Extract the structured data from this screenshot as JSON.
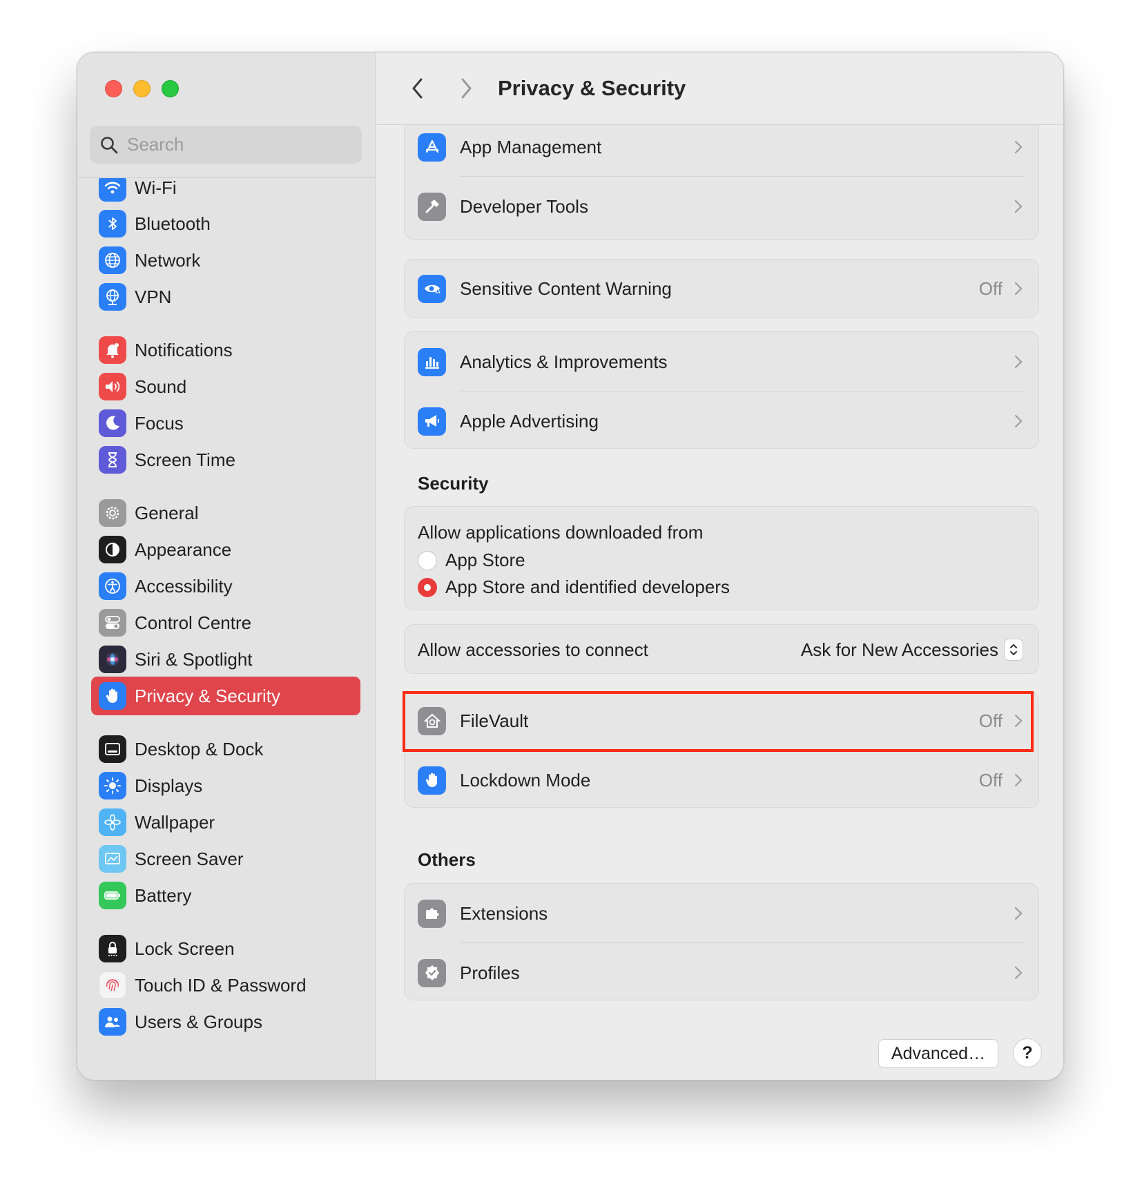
{
  "window": {
    "title": "Privacy & Security"
  },
  "search": {
    "placeholder": "Search"
  },
  "sidebar": {
    "items": [
      {
        "label": "Wi-Fi",
        "icon": "wifi-icon",
        "color": "#2b7ff6"
      },
      {
        "label": "Bluetooth",
        "icon": "bluetooth-icon",
        "color": "#2b7ff6"
      },
      {
        "label": "Network",
        "icon": "globe-icon",
        "color": "#2b7ff6"
      },
      {
        "label": "VPN",
        "icon": "vpn-globe-icon",
        "color": "#2b7ff6"
      },
      {
        "label": "Notifications",
        "icon": "bell-icon",
        "color": "#ef4a4a"
      },
      {
        "label": "Sound",
        "icon": "speaker-icon",
        "color": "#ef4a4a"
      },
      {
        "label": "Focus",
        "icon": "moon-icon",
        "color": "#5f5ad8"
      },
      {
        "label": "Screen Time",
        "icon": "hourglass-icon",
        "color": "#5f5ad8"
      },
      {
        "label": "General",
        "icon": "gear-icon",
        "color": "#9a9a9a"
      },
      {
        "label": "Appearance",
        "icon": "appearance-icon",
        "color": "#1e1e1e"
      },
      {
        "label": "Accessibility",
        "icon": "accessibility-icon",
        "color": "#2b7ff6"
      },
      {
        "label": "Control Centre",
        "icon": "toggles-icon",
        "color": "#9a9a9a"
      },
      {
        "label": "Siri & Spotlight",
        "icon": "siri-icon",
        "color": "#2a2a3a"
      },
      {
        "label": "Privacy & Security",
        "icon": "hand-icon",
        "color": "#2b7ff6",
        "active": true
      },
      {
        "label": "Desktop & Dock",
        "icon": "dock-icon",
        "color": "#1e1e1e"
      },
      {
        "label": "Displays",
        "icon": "sun-icon",
        "color": "#2b7ff6"
      },
      {
        "label": "Wallpaper",
        "icon": "flower-icon",
        "color": "#4fb3f6"
      },
      {
        "label": "Screen Saver",
        "icon": "screensaver-icon",
        "color": "#6ec7f2"
      },
      {
        "label": "Battery",
        "icon": "battery-icon",
        "color": "#34c759"
      },
      {
        "label": "Lock Screen",
        "icon": "lock-icon",
        "color": "#1e1e1e"
      },
      {
        "label": "Touch ID & Password",
        "icon": "fingerprint-icon",
        "color": "#f4f4f4"
      },
      {
        "label": "Users & Groups",
        "icon": "users-icon",
        "color": "#2b7ff6"
      }
    ]
  },
  "privacy": {
    "app_management": "App Management",
    "developer_tools": "Developer Tools",
    "sensitive_content": {
      "label": "Sensitive Content Warning",
      "value": "Off"
    },
    "analytics": "Analytics & Improvements",
    "advertising": "Apple Advertising"
  },
  "security": {
    "title": "Security",
    "allow_apps_label": "Allow applications downloaded from",
    "options": [
      {
        "label": "App Store",
        "selected": false
      },
      {
        "label": "App Store and identified developers",
        "selected": true
      }
    ],
    "accessories": {
      "label": "Allow accessories to connect",
      "value": "Ask for New Accessories"
    },
    "filevault": {
      "label": "FileVault",
      "value": "Off"
    },
    "lockdown": {
      "label": "Lockdown Mode",
      "value": "Off"
    }
  },
  "others": {
    "title": "Others",
    "extensions": "Extensions",
    "profiles": "Profiles"
  },
  "footer": {
    "advanced": "Advanced…",
    "help": "?"
  },
  "colors": {
    "accent_red": "#e0454c",
    "highlight_border": "#ff2a14",
    "icon_blue": "#2b7ff6",
    "icon_gray": "#8e8e93"
  }
}
